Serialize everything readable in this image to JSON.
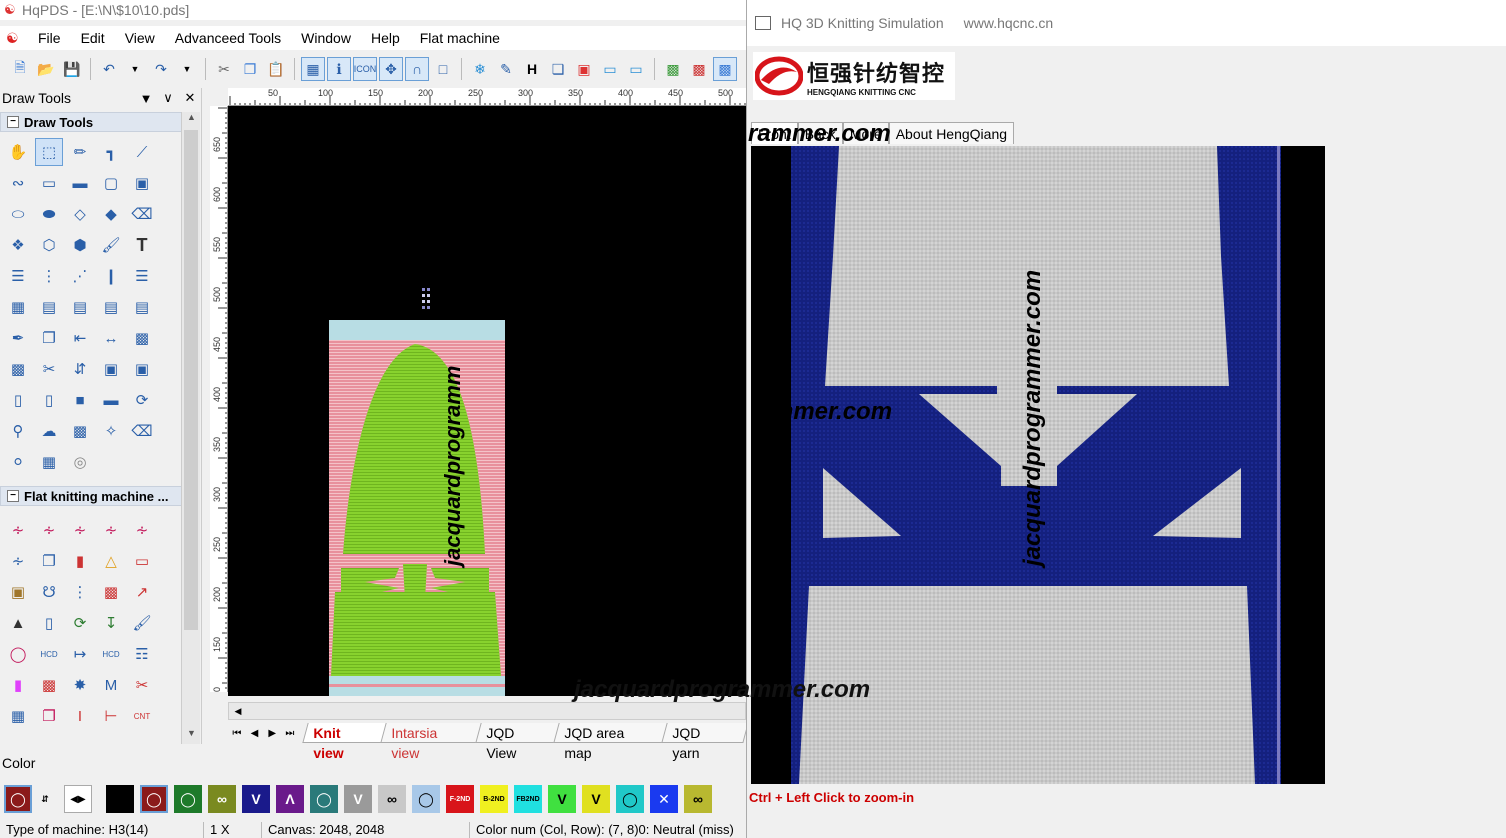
{
  "app": {
    "title": "HqPDS - [E:\\N\\$10\\10.pds]",
    "menu": [
      "File",
      "Edit",
      "View",
      "Advanceed Tools",
      "Window",
      "Help",
      "Flat machine"
    ]
  },
  "panel": {
    "header": "Draw Tools",
    "section_draw": "Draw Tools",
    "section_flat": "Flat knitting machine ...",
    "text_tool_glyph": "T"
  },
  "ruler": {
    "top": [
      "50",
      "100",
      "150",
      "200",
      "250",
      "300",
      "350",
      "400",
      "450",
      "500"
    ],
    "left": [
      "650",
      "600",
      "550",
      "500",
      "450",
      "400",
      "350",
      "300",
      "250",
      "200",
      "150",
      "100",
      "50"
    ]
  },
  "canvas": {
    "watermark": "jacquardprogramm",
    "colors": {
      "background": "#000000",
      "pink": "#e8909c",
      "green": "#88d22e",
      "lightblue": "#b8dde4"
    }
  },
  "tabs": [
    "Knit view",
    "Intarsia view",
    "JQD View",
    "JQD area map",
    "JQD yarn"
  ],
  "color_section": {
    "label": "Color",
    "chip_labels": [
      "F-2ND",
      "B-2ND",
      "FB2ND"
    ]
  },
  "status": {
    "machine": "Type of machine: H3(14)",
    "zoom": "1 X",
    "canvas": "Canvas: 2048, 2048",
    "colornum": "Color num (Col, Row): (7, 8)0: Neutral (miss)"
  },
  "sim": {
    "title": "HQ 3D Knitting Simulation",
    "url": "www.hqcnc.cn",
    "logo_cn": "恒强针纺智控",
    "logo_en": "HENGQIANG KNITTING CNC",
    "tabs": [
      "Front",
      "Back",
      "More",
      "About HengQiang"
    ],
    "hint": "Ctrl + Left Click to zoom-in",
    "watermark_v": "jacquardprogrammer.com",
    "watermark_h1": "rammer.com",
    "watermark_h2": "mmer.com",
    "watermark_h3": "jacquardprogrammer.com",
    "colors": {
      "navy": "#14207e",
      "grey": "#c8c8c8",
      "brand_red": "#d7141a"
    }
  }
}
